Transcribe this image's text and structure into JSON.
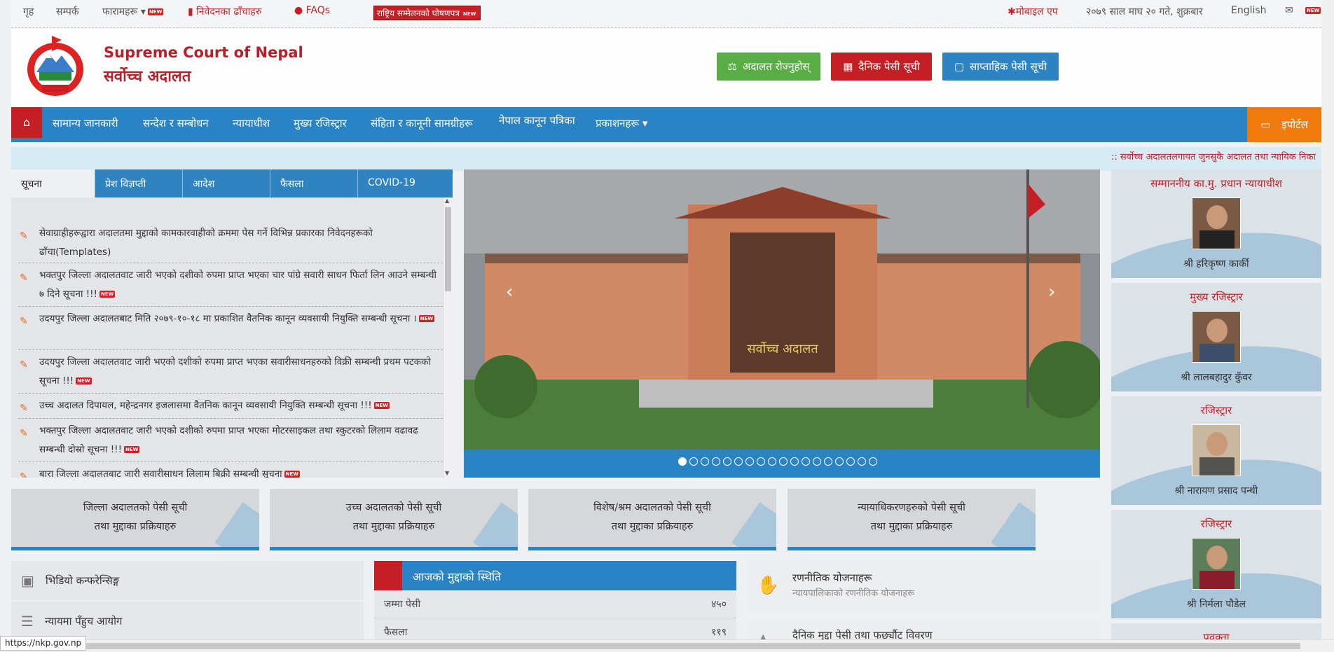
{
  "topbar": {
    "home": "गृह",
    "contact": "सम्पर्क",
    "forms": "फारामहरू",
    "new": "NEW",
    "application_drafts": "निवेदनका ढाँचाहरु",
    "faqs": "FAQs",
    "national_conf": "राष्ट्रिय सम्मेलनको घोषणपत्र",
    "mobile_app": "मोबाइल एप",
    "date": "२०७९ साल माघ २० गते, शुक्रबार",
    "english": "English"
  },
  "header": {
    "title_en": "Supreme Court of Nepal",
    "title_np": "सर्वोच्च अदालत",
    "btn_court": "अदालत रोज्नुहोस्",
    "btn_daily": "दैनिक पेसी सूची",
    "btn_weekly": "साप्ताहिक पेसी सूची",
    "colors": {
      "green": "#5aac44",
      "red": "#c41f24",
      "blue": "#2d84c4",
      "orange": "#f07a0c"
    }
  },
  "nav": {
    "items": [
      "सामान्य जानकारी",
      "सन्देश र सम्बोधन",
      "न्यायाधीश",
      "मुख्य रजिस्ट्रार",
      "संहिता र कानूनी सामग्रीहरू",
      "नेपाल कानून पत्रिका",
      "प्रकाशनहरू"
    ],
    "eportal": "इपोर्टल"
  },
  "ticker": ":: सर्वोच्च अदालतलगायत जुनसुकै अदालत तथा न्यायिक निका",
  "tabs": [
    "सूचना",
    "प्रेश विज्ञप्ती",
    "आदेश",
    "फैसला",
    "COVID-19"
  ],
  "notices": [
    {
      "text": "सेवाग्राहीहरूद्वारा अदालतमा मुद्दाको कामकारवाहीको क्रममा पेस गर्ने विभिन्न प्रकारका निवेदनहरूको ढाँचा(Templates)",
      "new": false
    },
    {
      "text": "भक्तपुर जिल्ला अदालतवाट जारी भएको दशीको रुपमा प्राप्त भएका चार पांग्रे सवारी साधन फिर्ता लिन आउने सम्बन्धी ७ दिने सूचना !!!",
      "new": true
    },
    {
      "text": "उदयपुर जिल्ला अदालतबाट मिति २०७९-१०-१८ मा प्रकाशित वैतनिक कानून व्यवसायी नियुक्ति सम्बन्धी सूचना ।",
      "new": true
    },
    {
      "text": "उदयपुर जिल्ला अदालतवाट जारी भएको दशीको रुपमा प्राप्त भएका सवारीसाधनहरुको विक्री सम्बन्धी प्रथम पटकको सूचना !!!",
      "new": true
    },
    {
      "text": "उच्च अदालत दिपायल, महेन्द्रनगर इजलासमा वैतनिक कानून व्यवसायी नियुक्ति सम्बन्धी सूचना !!!",
      "new": true
    },
    {
      "text": "भक्तपुर जिल्ला अदालतवाट जारी भएको दशीको रुपमा प्राप्त भएका मोटरसाइकल तथा स्कुटरको लिलाम वढावढ सम्बन्धी दोस्रो सूचना !!!",
      "new": true
    },
    {
      "text": "बारा जिल्ला अदालतबाट जारी सवारीसाधन लिलाम बिक्री सम्बन्धी सूचना",
      "new": true
    }
  ],
  "carousel": {
    "image_text": "सर्वोच्च अदालत",
    "dots": 18,
    "active_dot": 0
  },
  "officials": [
    {
      "title": "सम्माननीय का.मु. प्रधान न्यायाधीश",
      "name": "श्री हरिकृष्ण कार्की"
    },
    {
      "title": "मुख्य रजिस्ट्रार",
      "name": "श्री लालबहादुर कुँवर"
    },
    {
      "title": "रजिस्ट्रार",
      "name": "श्री नारायण प्रसाद पन्थी"
    },
    {
      "title": "रजिस्ट्रार",
      "name": "श्री निर्मला पौडेल"
    },
    {
      "title": "प्रवक्ता",
      "name": ""
    }
  ],
  "boxes": [
    {
      "l1": "जिल्ला अदालतको पेसी सूची",
      "l2": "तथा मुद्दाका प्रक्रियाहरु"
    },
    {
      "l1": "उच्च अदालतको पेसी सूची",
      "l2": "तथा मुद्दाका प्रक्रियाहरु"
    },
    {
      "l1": "विशेष/श्रम अदालतको पेसी सूची",
      "l2": "तथा मुद्दाका प्रक्रियाहरु"
    },
    {
      "l1": "न्यायाधिकरणहरुको पेसी सूची",
      "l2": "तथा मुद्दाका प्रक्रियाहरु"
    }
  ],
  "links": [
    "भिडियो कन्फरेन्सिङ्ग",
    "न्यायमा पँहुच आयोग"
  ],
  "status": {
    "title": "आजको मुद्दाको स्थिति",
    "rows": [
      {
        "label": "जम्मा पेसी",
        "value": "४५०"
      },
      {
        "label": "फैसला",
        "value": "११९"
      }
    ]
  },
  "plans": [
    {
      "title": "रणनीतिक योजनाहरू",
      "sub": "न्यायपालिकाको रणनीतिक योजनाहरू"
    },
    {
      "title": "दैनिक मुद्दा पेसी तथा फर्छ्यौट विवरण",
      "sub": ""
    }
  ],
  "statusbar_url": "https://nkp.gov.np"
}
